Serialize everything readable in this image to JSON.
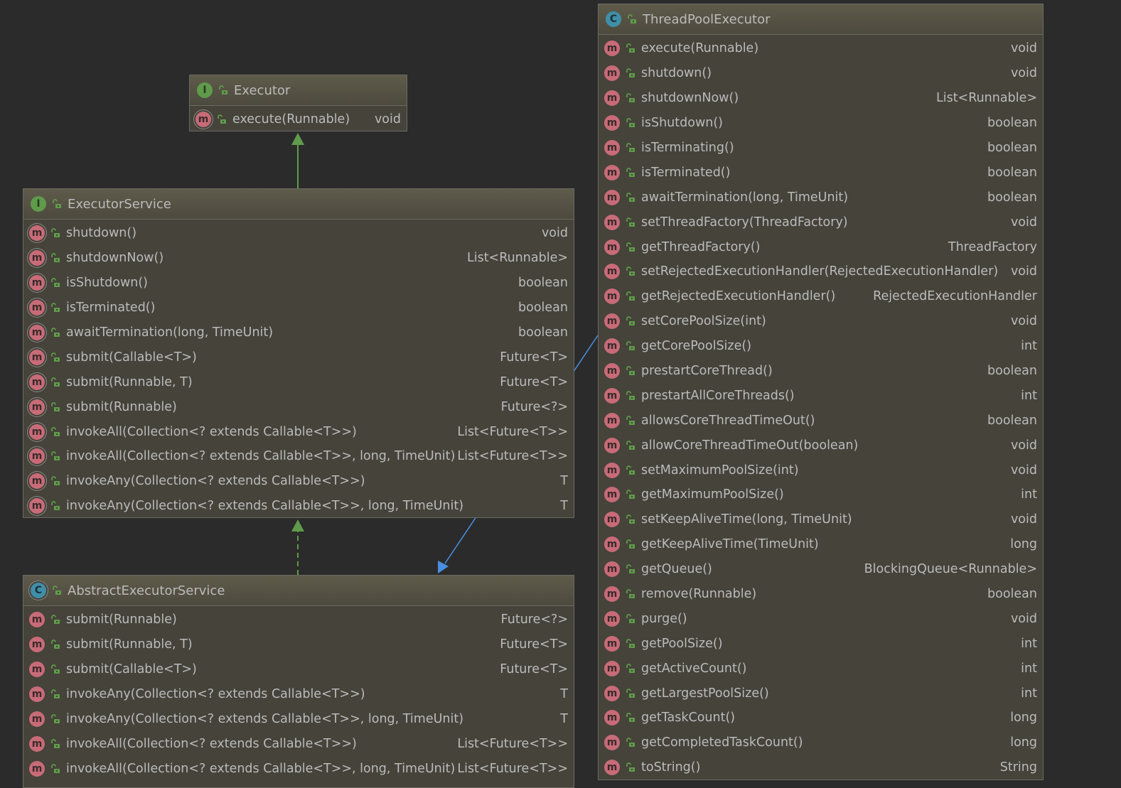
{
  "colors": {
    "background": "#2b2b2b",
    "box": "#45433a",
    "text": "#bbbbbb",
    "method_icon": "#c86b78",
    "interface_icon": "#5f9b4a",
    "class_icon": "#3f8fa8",
    "realization_arrow": "#5f9b4a",
    "dependency_arrow": "#4a90e2"
  },
  "boxes": [
    {
      "id": "executor",
      "kind": "interface",
      "icon": "interface-icon",
      "title": "Executor",
      "methods": [
        {
          "name": "execute(Runnable)",
          "type": "void",
          "abstract": true
        }
      ]
    },
    {
      "id": "executor-service",
      "kind": "interface",
      "icon": "interface-icon",
      "title": "ExecutorService",
      "methods": [
        {
          "name": "shutdown()",
          "type": "void",
          "abstract": true
        },
        {
          "name": "shutdownNow()",
          "type": "List<Runnable>",
          "abstract": true
        },
        {
          "name": "isShutdown()",
          "type": "boolean",
          "abstract": true
        },
        {
          "name": "isTerminated()",
          "type": "boolean",
          "abstract": true
        },
        {
          "name": "awaitTermination(long, TimeUnit)",
          "type": "boolean",
          "abstract": true
        },
        {
          "name": "submit(Callable<T>)",
          "type": "Future<T>",
          "abstract": true
        },
        {
          "name": "submit(Runnable, T)",
          "type": "Future<T>",
          "abstract": true
        },
        {
          "name": "submit(Runnable)",
          "type": "Future<?>",
          "abstract": true
        },
        {
          "name": "invokeAll(Collection<? extends Callable<T>>)",
          "type": "List<Future<T>>",
          "abstract": true
        },
        {
          "name": "invokeAll(Collection<? extends Callable<T>>, long, TimeUnit)",
          "type": "List<Future<T>>",
          "abstract": true
        },
        {
          "name": "invokeAny(Collection<? extends Callable<T>>)",
          "type": "T",
          "abstract": true
        },
        {
          "name": "invokeAny(Collection<? extends Callable<T>>, long, TimeUnit)",
          "type": "T",
          "abstract": true
        }
      ]
    },
    {
      "id": "abstract-executor-service",
      "kind": "abstract-class",
      "icon": "abstract-class-icon",
      "title": "AbstractExecutorService",
      "methods": [
        {
          "name": "submit(Runnable)",
          "type": "Future<?>"
        },
        {
          "name": "submit(Runnable, T)",
          "type": "Future<T>"
        },
        {
          "name": "submit(Callable<T>)",
          "type": "Future<T>"
        },
        {
          "name": "invokeAny(Collection<? extends Callable<T>>)",
          "type": "T"
        },
        {
          "name": "invokeAny(Collection<? extends Callable<T>>, long, TimeUnit)",
          "type": "T"
        },
        {
          "name": "invokeAll(Collection<? extends Callable<T>>)",
          "type": "List<Future<T>>"
        },
        {
          "name": "invokeAll(Collection<? extends Callable<T>>, long, TimeUnit)",
          "type": "List<Future<T>>"
        }
      ]
    },
    {
      "id": "thread-pool-executor",
      "kind": "class",
      "icon": "class-icon",
      "title": "ThreadPoolExecutor",
      "methods": [
        {
          "name": "execute(Runnable)",
          "type": "void"
        },
        {
          "name": "shutdown()",
          "type": "void"
        },
        {
          "name": "shutdownNow()",
          "type": "List<Runnable>"
        },
        {
          "name": "isShutdown()",
          "type": "boolean"
        },
        {
          "name": "isTerminating()",
          "type": "boolean"
        },
        {
          "name": "isTerminated()",
          "type": "boolean"
        },
        {
          "name": "awaitTermination(long, TimeUnit)",
          "type": "boolean"
        },
        {
          "name": "setThreadFactory(ThreadFactory)",
          "type": "void"
        },
        {
          "name": "getThreadFactory()",
          "type": "ThreadFactory"
        },
        {
          "name": "setRejectedExecutionHandler(RejectedExecutionHandler)",
          "type": "void"
        },
        {
          "name": "getRejectedExecutionHandler()",
          "type": "RejectedExecutionHandler"
        },
        {
          "name": "setCorePoolSize(int)",
          "type": "void"
        },
        {
          "name": "getCorePoolSize()",
          "type": "int"
        },
        {
          "name": "prestartCoreThread()",
          "type": "boolean"
        },
        {
          "name": "prestartAllCoreThreads()",
          "type": "int"
        },
        {
          "name": "allowsCoreThreadTimeOut()",
          "type": "boolean"
        },
        {
          "name": "allowCoreThreadTimeOut(boolean)",
          "type": "void"
        },
        {
          "name": "setMaximumPoolSize(int)",
          "type": "void"
        },
        {
          "name": "getMaximumPoolSize()",
          "type": "int"
        },
        {
          "name": "setKeepAliveTime(long, TimeUnit)",
          "type": "void"
        },
        {
          "name": "getKeepAliveTime(TimeUnit)",
          "type": "long"
        },
        {
          "name": "getQueue()",
          "type": "BlockingQueue<Runnable>"
        },
        {
          "name": "remove(Runnable)",
          "type": "boolean"
        },
        {
          "name": "purge()",
          "type": "void"
        },
        {
          "name": "getPoolSize()",
          "type": "int"
        },
        {
          "name": "getActiveCount()",
          "type": "int"
        },
        {
          "name": "getLargestPoolSize()",
          "type": "int"
        },
        {
          "name": "getTaskCount()",
          "type": "long"
        },
        {
          "name": "getCompletedTaskCount()",
          "type": "long"
        },
        {
          "name": "toString()",
          "type": "String"
        }
      ]
    }
  ],
  "relations": [
    {
      "from": "executor-service",
      "to": "executor",
      "type": "extends"
    },
    {
      "from": "abstract-executor-service",
      "to": "executor-service",
      "type": "implements"
    },
    {
      "from": "thread-pool-executor",
      "to": "abstract-executor-service",
      "type": "extends"
    }
  ]
}
